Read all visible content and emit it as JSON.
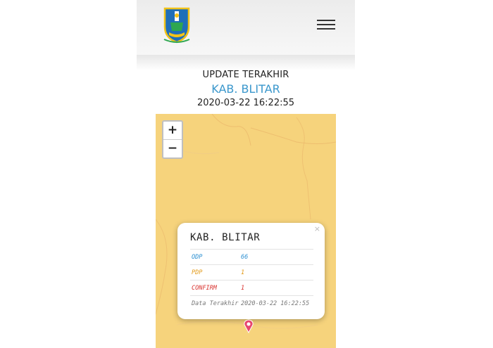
{
  "header": {
    "logo_icon": "east-java-coat-of-arms",
    "menu_icon": "hamburger-menu-icon"
  },
  "update": {
    "label": "UPDATE TERAKHIR",
    "region": "KAB. BLITAR",
    "timestamp": "2020-03-22 16:22:55"
  },
  "map": {
    "zoom_in": "+",
    "zoom_out": "−",
    "background_color": "#f6d37c"
  },
  "popup": {
    "close": "×",
    "title": "KAB. BLITAR",
    "rows": [
      {
        "label": "ODP",
        "value": "66"
      },
      {
        "label": "PDP",
        "value": "1"
      },
      {
        "label": "CONFIRM",
        "value": "1"
      },
      {
        "label": "Data Terakhir",
        "value": "2020-03-22 16:22:55"
      }
    ]
  },
  "colors": {
    "accent": "#3a97cc",
    "odp": "#2b8fd1",
    "pdp": "#e39a19",
    "confirm": "#d9332f",
    "marker": "#e8476f"
  }
}
